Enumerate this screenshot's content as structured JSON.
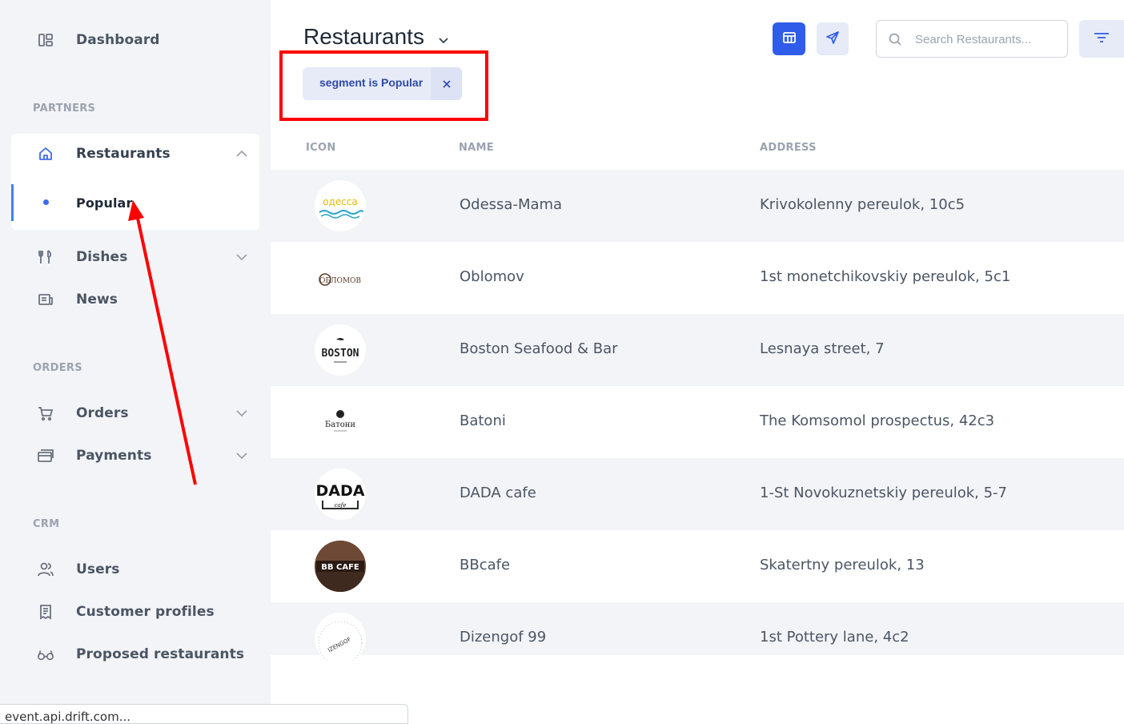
{
  "sidebar": {
    "dashboard": "Dashboard",
    "sections": {
      "partners": "PARTNERS",
      "orders": "ORDERS",
      "crm": "CRM"
    },
    "restaurants": "Restaurants",
    "popular": "Popular",
    "dishes": "Dishes",
    "news": "News",
    "orders": "Orders",
    "payments": "Payments",
    "users": "Users",
    "customer_profiles": "Customer profiles",
    "proposed_restaurants": "Proposed restaurants"
  },
  "status_bar": {
    "text": "event.api.drift.com..."
  },
  "header": {
    "title": "Restaurants",
    "search_placeholder": "Search Restaurants..."
  },
  "filter_chip": {
    "label": "segment is Popular"
  },
  "table": {
    "columns": {
      "icon": "ICON",
      "name": "NAME",
      "address": "ADDRESS"
    },
    "rows": [
      {
        "name": "Odessa-Mama",
        "address": "Krivokolenny pereulok, 10c5",
        "logo_text": "одесса"
      },
      {
        "name": "Oblomov",
        "address": "1st monetchikovskiy pereulok, 5c1",
        "logo_text": "ОБЛОМОВ"
      },
      {
        "name": "Boston Seafood & Bar",
        "address": "Lesnaya street, 7",
        "logo_text": "BOSTON"
      },
      {
        "name": "Batoni",
        "address": "The Komsomol prospectus, 42c3",
        "logo_text": "Батони"
      },
      {
        "name": "DADA cafe",
        "address": "1-St Novokuznetskiy pereulok, 5-7",
        "logo_text": "DADA"
      },
      {
        "name": "BBcafe",
        "address": "Skatertny pereulok, 13",
        "logo_text": "BB CAFE"
      },
      {
        "name": "Dizengof 99",
        "address": "1st Pottery lane, 4c2",
        "logo_text": "IZENGOF"
      }
    ]
  },
  "colors": {
    "accent": "#2f5ce8",
    "annotation": "#ff0000",
    "sidebar_bg": "#f3f4f7"
  }
}
